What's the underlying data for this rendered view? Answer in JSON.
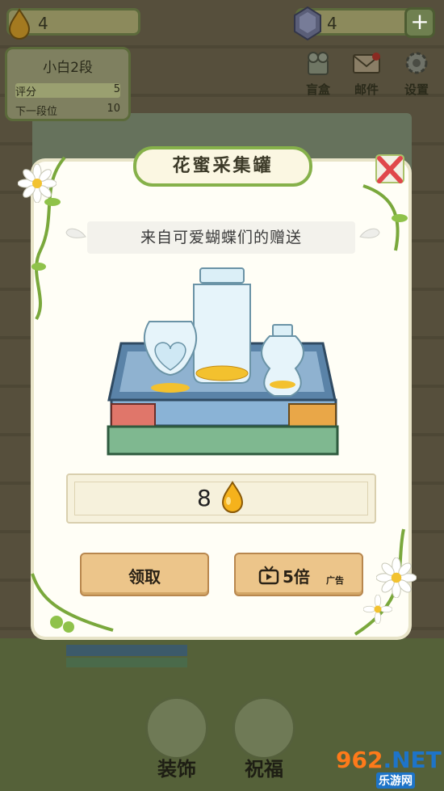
{
  "topbar": {
    "honey_count": "4",
    "gem_count": "4",
    "add_button": "+"
  },
  "rank": {
    "title": "小白2段",
    "score_label": "评分",
    "score_value": "5",
    "next_label": "下一段位",
    "next_value": "10"
  },
  "top_icons": [
    {
      "label": "盲盒",
      "icon": "blind-box-icon"
    },
    {
      "label": "邮件",
      "icon": "mail-icon"
    },
    {
      "label": "设置",
      "icon": "gear-icon"
    }
  ],
  "dialog": {
    "title": "花蜜采集罐",
    "subtitle": "来自可爱蝴蝶们的赠送",
    "amount": "8",
    "claim_label": "领取",
    "ad_multiplier_label": "5倍",
    "ad_tag": "广告"
  },
  "bottom": {
    "decorate_label": "装饰",
    "bless_label": "祝福"
  },
  "watermark": {
    "number": "962",
    "suffix": ".NET",
    "site": "乐游网"
  },
  "colors": {
    "dialog_bg": "#fffef6",
    "button_bg": "#ecc58a",
    "vine_green": "#86b14a",
    "honey_yellow": "#f5b21c"
  }
}
